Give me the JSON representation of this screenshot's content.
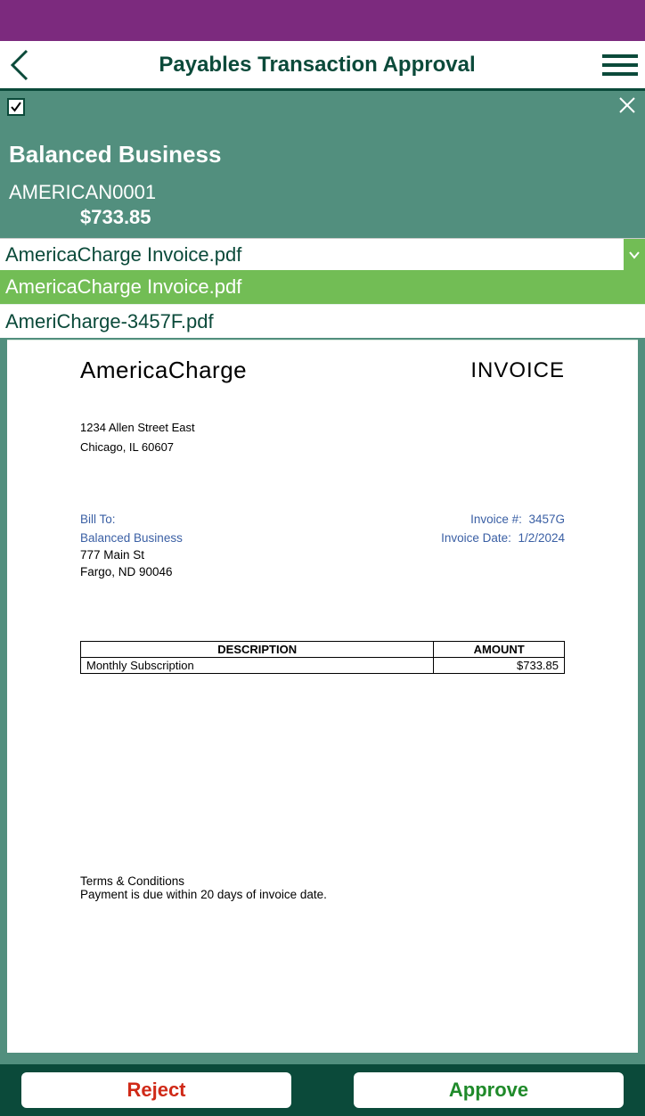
{
  "header": {
    "title": "Payables Transaction Approval"
  },
  "transaction": {
    "checked": true,
    "vendor_name": "Balanced Business",
    "vendor_code": "AMERICAN0001",
    "amount": "$733.85"
  },
  "attachment_picker": {
    "selected": "AmericaCharge Invoice.pdf",
    "options": [
      {
        "label": "AmericaCharge Invoice.pdf",
        "active": true
      },
      {
        "label": "AmeriCharge-3457F.pdf",
        "active": false
      }
    ]
  },
  "invoice": {
    "company": "AmericaCharge",
    "doc_label": "INVOICE",
    "company_addr1": "1234 Allen Street East",
    "company_addr2": "Chicago, IL 60607",
    "bill_to_label": "Bill To:",
    "bill_to_name": "Balanced Business",
    "bill_to_addr1": "777 Main St",
    "bill_to_addr2": "Fargo, ND 90046",
    "invoice_num_label": "Invoice #:",
    "invoice_num": "3457G",
    "invoice_date_label": "Invoice Date:",
    "invoice_date": "1/2/2024",
    "col_desc": "DESCRIPTION",
    "col_amt": "AMOUNT",
    "line_desc": "Monthly Subscription",
    "line_amt": "$733.85",
    "terms_label": "Terms & Conditions",
    "terms_text": "Payment is due within 20 days of invoice date."
  },
  "actions": {
    "reject": "Reject",
    "approve": "Approve"
  }
}
